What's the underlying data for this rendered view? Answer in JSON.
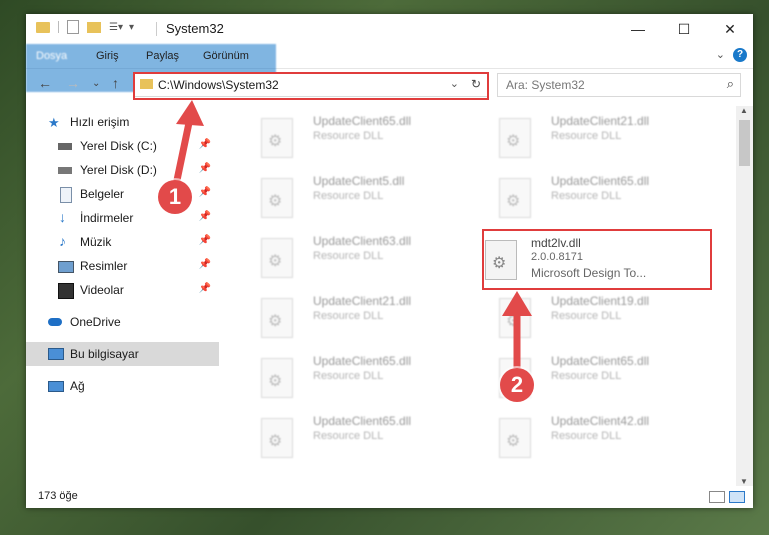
{
  "window": {
    "title": "System32",
    "controls": {
      "minimize": "—",
      "maximize": "☐",
      "close": "✕"
    }
  },
  "ribbon": {
    "tabs": [
      "Dosya",
      "Giriş",
      "Paylaş",
      "Görünüm"
    ],
    "help": "?"
  },
  "address": {
    "path": "C:\\Windows\\System32",
    "search_placeholder": "Ara: System32"
  },
  "nav": {
    "items": [
      {
        "label": "Hızlı erişim",
        "icon": "star-icon",
        "pinned": false
      },
      {
        "label": "Yerel Disk (C:)",
        "icon": "drive-icon",
        "pinned": true
      },
      {
        "label": "Yerel Disk (D:)",
        "icon": "drive-icon",
        "pinned": true
      },
      {
        "label": "Belgeler",
        "icon": "document-icon",
        "pinned": true
      },
      {
        "label": "İndirmeler",
        "icon": "download-icon",
        "pinned": true
      },
      {
        "label": "Müzik",
        "icon": "music-icon",
        "pinned": true
      },
      {
        "label": "Resimler",
        "icon": "picture-icon",
        "pinned": true
      },
      {
        "label": "Videolar",
        "icon": "video-icon",
        "pinned": true
      },
      {
        "label": "OneDrive",
        "icon": "cloud-icon",
        "pinned": false
      },
      {
        "label": "Bu bilgisayar",
        "icon": "computer-icon",
        "pinned": false
      },
      {
        "label": "Ağ",
        "icon": "network-icon",
        "pinned": false
      }
    ]
  },
  "files": {
    "left": [
      {
        "name": "UpdateClient65.dll",
        "type": "Resource DLL"
      },
      {
        "name": "UpdateClient5.dll",
        "type": "Resource DLL"
      },
      {
        "name": "UpdateClient63.dll",
        "type": "Resource DLL"
      },
      {
        "name": "UpdateClient21.dll",
        "type": "Resource DLL"
      },
      {
        "name": "UpdateClient65.dll",
        "type": "Resource DLL"
      },
      {
        "name": "UpdateClient65.dll",
        "type": "Resource DLL"
      }
    ],
    "right": [
      {
        "name": "UpdateClient21.dll",
        "type": "Resource DLL"
      },
      {
        "name": "UpdateClient65.dll",
        "type": "Resource DLL"
      },
      {
        "name": "UpdateClient19.dll",
        "type": "Resource DLL"
      },
      {
        "name": "UpdateClient65.dll",
        "type": "Resource DLL"
      },
      {
        "name": "UpdateClient42.dll",
        "type": "Resource DLL"
      }
    ],
    "highlighted": {
      "name": "mdt2lv.dll",
      "version": "2.0.0.8171",
      "description": "Microsoft Design To..."
    }
  },
  "status": {
    "count": "173 öğe"
  },
  "annotations": {
    "badge1": "1",
    "badge2": "2",
    "color": "#e03c3c"
  }
}
